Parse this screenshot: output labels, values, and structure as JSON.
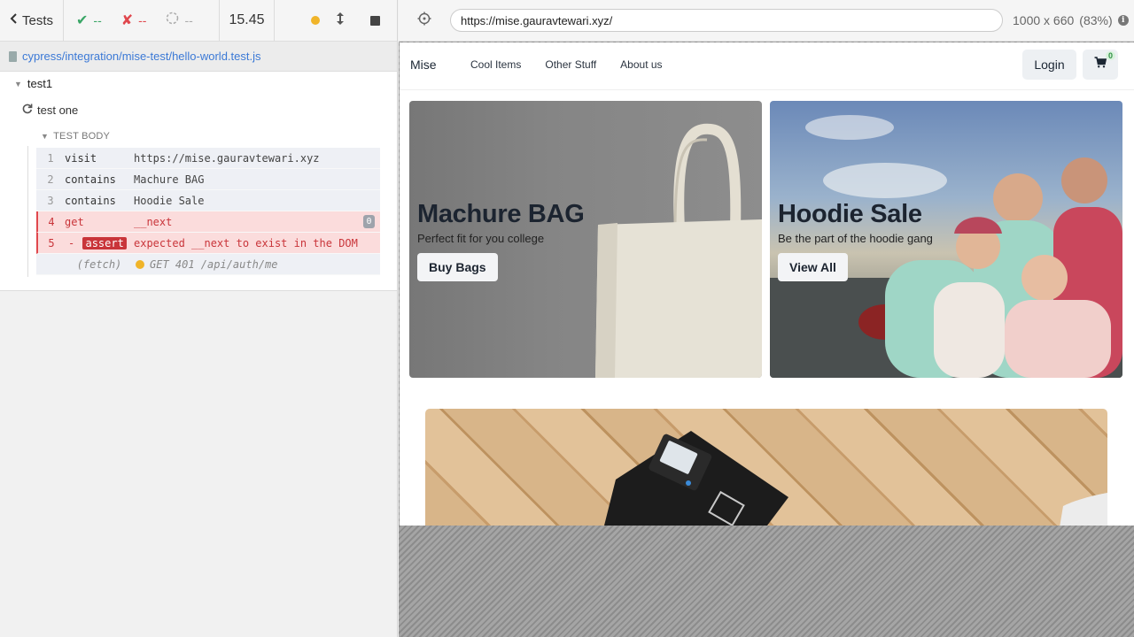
{
  "reporter": {
    "back_label": "Tests",
    "stats": {
      "passed": "--",
      "failed": "--",
      "pending": "--"
    },
    "duration": "15.45",
    "spec_path": "cypress/integration/mise-test/hello-world.test.js",
    "suite_title": "test1",
    "test_title": "test one",
    "body_label": "TEST BODY",
    "commands": [
      {
        "num": "1",
        "name": "visit",
        "message": "https://mise.gauravtewari.xyz"
      },
      {
        "num": "2",
        "name": "contains",
        "message": "Machure BAG"
      },
      {
        "num": "3",
        "name": "contains",
        "message": "Hoodie Sale"
      },
      {
        "num": "4",
        "name": "get",
        "message": "__next",
        "count": "0"
      },
      {
        "num": "5",
        "name": "assert",
        "prefix": "-",
        "message": "expected __next to exist in the DOM"
      },
      {
        "num": "",
        "name": "(fetch)",
        "message": "GET 401 /api/auth/me"
      }
    ],
    "colors": {
      "pass": "#3aa666",
      "fail": "#e0474d",
      "link": "#3b79d6",
      "running": "#f0b429"
    }
  },
  "aut": {
    "url": "https://mise.gauravtewari.xyz/",
    "viewport": "1000 x 660",
    "scale": "(83%)",
    "app": {
      "brand": "Mise",
      "nav_links": [
        "Cool Items",
        "Other Stuff",
        "About us"
      ],
      "login_label": "Login",
      "cart_count": "0",
      "banners": [
        {
          "title": "Machure BAG",
          "subtitle": "Perfect fit for you college",
          "cta": "Buy Bags"
        },
        {
          "title": "Hoodie Sale",
          "subtitle": "Be the part of the hoodie gang",
          "cta": "View All"
        }
      ]
    }
  }
}
